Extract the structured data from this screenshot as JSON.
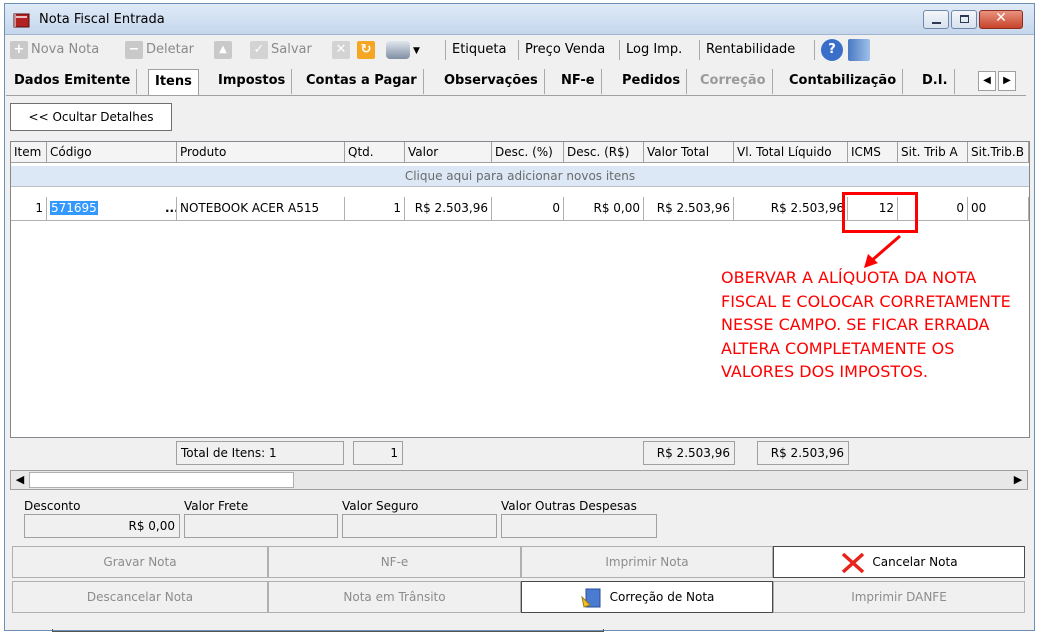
{
  "window": {
    "title": "Nota Fiscal Entrada",
    "title_icon": "book-icon"
  },
  "toolbar": {
    "nova_nota": "Nova Nota",
    "deletar": "Deletar",
    "salvar": "Salvar",
    "etiqueta": "Etiqueta",
    "preco_venda": "Preço Venda",
    "log_imp": "Log Imp.",
    "rentabilidade": "Rentabilidade"
  },
  "tabs": [
    {
      "label": "Dados Emitente"
    },
    {
      "label": "Itens"
    },
    {
      "label": "Impostos"
    },
    {
      "label": "Contas a Pagar"
    },
    {
      "label": "Observações"
    },
    {
      "label": "NF-e"
    },
    {
      "label": "Pedidos"
    },
    {
      "label": "Correção"
    },
    {
      "label": "Contabilização"
    },
    {
      "label": "D.I."
    }
  ],
  "hide_details": "<< Ocultar Detalhes",
  "grid": {
    "columns": [
      "Item",
      "Código",
      "Produto",
      "Qtd.",
      "Valor",
      "Desc. (%)",
      "Desc. (R$)",
      "Valor Total",
      "Vl. Total Líquido",
      "ICMS",
      "Sit. Trib A",
      "Sit.Trib.B"
    ],
    "add_row_hint": "Clique aqui para adicionar novos itens",
    "rows": [
      {
        "item": "1",
        "codigo": "571695",
        "dots": "...",
        "produto": "NOTEBOOK ACER A515",
        "qtd": "1",
        "valor": "R$ 2.503,96",
        "desc_pct": "0",
        "desc_rs": "R$ 0,00",
        "valor_total": "R$ 2.503,96",
        "vl_total_liquido": "R$ 2.503,96",
        "icms": "12",
        "sit_trib_a": "0",
        "sit_trib_b": "00"
      }
    ]
  },
  "annotation": {
    "lines": [
      "OBERVAR A ALÍQUOTA DA NOTA",
      "FISCAL E COLOCAR CORRETAMENTE",
      "NESSE CAMPO. SE FICAR ERRADA",
      "ALTERA COMPLETAMENTE OS",
      "VALORES DOS IMPOSTOS."
    ],
    "color": "#ff0000"
  },
  "totals": {
    "total_itens": "Total de Itens: 1",
    "qtd": "1",
    "valor_total": "R$ 2.503,96",
    "vl_total_liquido": "R$ 2.503,96"
  },
  "fields": {
    "desconto_label": "Desconto",
    "desconto_value": "R$ 0,00",
    "frete_label": "Valor Frete",
    "seguro_label": "Valor Seguro",
    "outras_label": "Valor Outras Despesas"
  },
  "actions": {
    "gravar": "Gravar Nota",
    "nfe": "NF-e",
    "imprimir": "Imprimir Nota",
    "cancelar": "Cancelar Nota",
    "descancelar": "Descancelar Nota",
    "transito": "Nota em Trânsito",
    "correcao": "Correção de Nota",
    "danfe": "Imprimir DANFE"
  }
}
